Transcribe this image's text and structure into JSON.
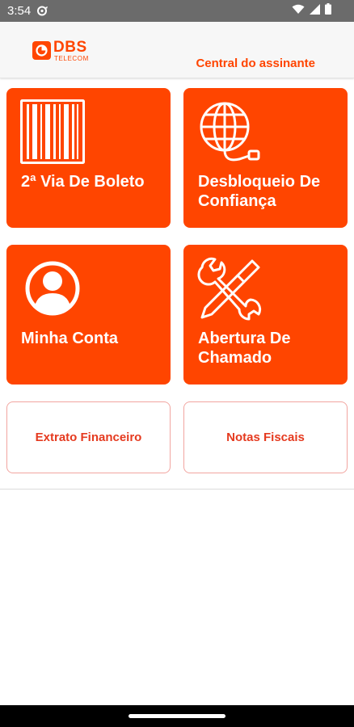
{
  "status_bar": {
    "time": "3:54",
    "icons": [
      "notification-icon",
      "wifi-icon",
      "signal-icon",
      "battery-icon"
    ]
  },
  "header": {
    "logo_text": "DBS",
    "logo_subtext": "TELECOM",
    "title": "Central do assinante"
  },
  "tiles": [
    {
      "label": "2ª Via De Boleto",
      "icon": "barcode-icon"
    },
    {
      "label": "Desbloqueio De Confiança",
      "icon": "globe-network-icon"
    },
    {
      "label": "Minha Conta",
      "icon": "user-icon"
    },
    {
      "label": "Abertura De Chamado",
      "icon": "tools-icon"
    }
  ],
  "buttons": [
    {
      "label": "Extrato Financeiro"
    },
    {
      "label": "Notas Fiscais"
    }
  ],
  "colors": {
    "accent": "#ff4500",
    "status_bar": "#6b6b6b",
    "button_text": "#e53a1f",
    "button_border": "#f2a5a0"
  }
}
